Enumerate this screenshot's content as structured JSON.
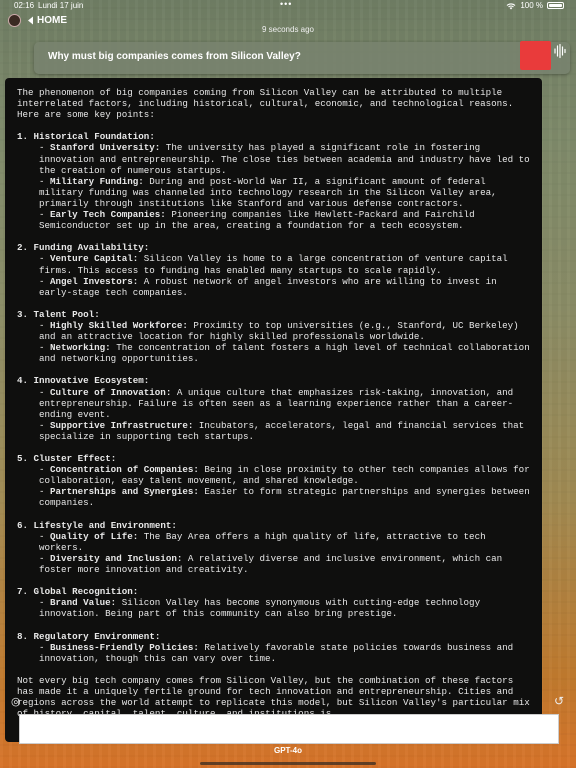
{
  "status": {
    "time": "02:16",
    "date": "Lundi 17 juin",
    "battery": "100 %",
    "wifi_icon": "wifi-icon",
    "battery_icon": "battery-icon"
  },
  "nav": {
    "home_label": "HOME",
    "back_icon": "chevron-left-icon"
  },
  "timestamp": "9 seconds ago",
  "question": "Why must big companies comes from Silicon Valley?",
  "stop_button_color": "#e93b3b",
  "response": {
    "intro": "The phenomenon of big companies coming from Silicon Valley can be attributed to multiple interrelated factors, including historical, cultural, economic, and technological reasons. Here are some key points:",
    "sections": [
      {
        "heading": "1. Historical Foundation:",
        "items": [
          {
            "term": "Stanford University:",
            "text": " The university has played a significant role in fostering innovation and entrepreneurship. The close ties between academia and industry have led to the creation of numerous startups."
          },
          {
            "term": "Military Funding:",
            "text": " During and post-World War II, a significant amount of federal military funding was channeled into technology research in the Silicon Valley area, primarily through institutions like Stanford and various defense contractors."
          },
          {
            "term": "Early Tech Companies:",
            "text": " Pioneering companies like Hewlett-Packard and Fairchild Semiconductor set up in the area, creating a foundation for a tech ecosystem."
          }
        ]
      },
      {
        "heading": "2. Funding Availability:",
        "items": [
          {
            "term": "Venture Capital:",
            "text": " Silicon Valley is home to a large concentration of venture capital firms. This access to funding has enabled many startups to scale rapidly."
          },
          {
            "term": "Angel Investors:",
            "text": " A robust network of angel investors who are willing to invest in early-stage tech companies."
          }
        ]
      },
      {
        "heading": "3. Talent Pool:",
        "items": [
          {
            "term": "Highly Skilled Workforce:",
            "text": " Proximity to top universities (e.g., Stanford, UC Berkeley) and an attractive location for highly skilled professionals worldwide."
          },
          {
            "term": "Networking:",
            "text": " The concentration of talent fosters a high level of technical collaboration and networking opportunities."
          }
        ]
      },
      {
        "heading": "4. Innovative Ecosystem:",
        "items": [
          {
            "term": "Culture of Innovation:",
            "text": " A unique culture that emphasizes risk-taking, innovation, and entrepreneurship. Failure is often seen as a learning experience rather than a career-ending event."
          },
          {
            "term": "Supportive Infrastructure:",
            "text": " Incubators, accelerators, legal and financial services that specialize in supporting tech startups."
          }
        ]
      },
      {
        "heading": "5. Cluster Effect:",
        "items": [
          {
            "term": "Concentration of Companies:",
            "text": " Being in close proximity to other tech companies allows for collaboration, easy talent movement, and shared knowledge."
          },
          {
            "term": "Partnerships and Synergies:",
            "text": " Easier to form strategic partnerships and synergies between companies."
          }
        ]
      },
      {
        "heading": "6. Lifestyle and Environment:",
        "items": [
          {
            "term": "Quality of Life:",
            "text": " The Bay Area offers a high quality of life, attractive to tech workers."
          },
          {
            "term": "Diversity and Inclusion:",
            "text": " A relatively diverse and inclusive environment, which can foster more innovation and creativity."
          }
        ]
      },
      {
        "heading": "7. Global Recognition:",
        "items": [
          {
            "term": "Brand Value:",
            "text": " Silicon Valley has become synonymous with cutting-edge technology innovation. Being part of this community can also bring prestige."
          }
        ]
      },
      {
        "heading": "8. Regulatory Environment:",
        "items": [
          {
            "term": "Business-Friendly Policies:",
            "text": " Relatively favorable state policies towards business and innovation, though this can vary over time."
          }
        ]
      }
    ],
    "outro": "Not every big tech company comes from Silicon Valley, but the combination of these factors has made it a uniquely fertile ground for tech innovation and entrepreneurship. Cities and regions across the world attempt to replicate this model, but Silicon Valley's particular mix of history, capital, talent, culture, and institutions is"
  },
  "input": {
    "value": "",
    "placeholder": ""
  },
  "model_label": "GPT-4o"
}
